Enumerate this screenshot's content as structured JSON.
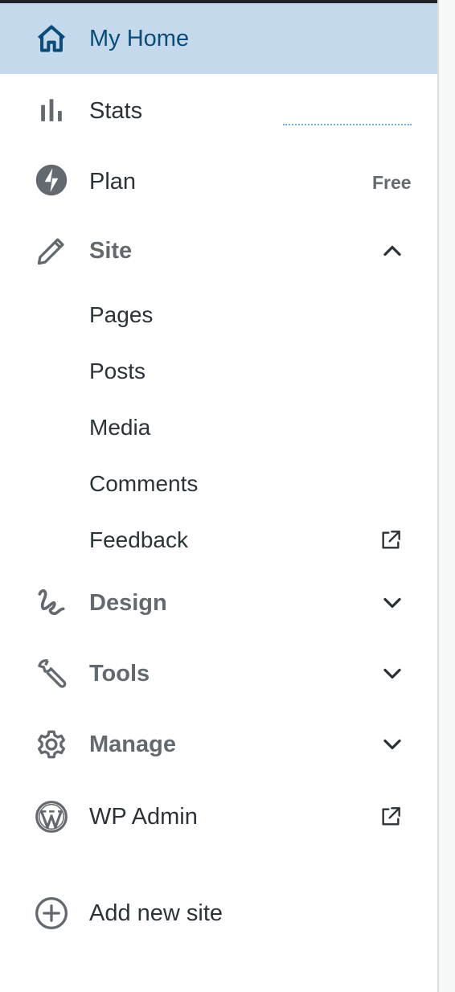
{
  "colors": {
    "selected_bg": "#c5d9ed",
    "selected_text": "#0a4b78",
    "icon_gray": "#646970",
    "text": "#2c3338",
    "sparkline": "#72aee6"
  },
  "nav": {
    "my_home": {
      "label": "My Home",
      "icon": "home-icon"
    },
    "stats": {
      "label": "Stats",
      "icon": "stats-bar-icon"
    },
    "plan": {
      "label": "Plan",
      "icon": "jetpack-bolt-icon",
      "badge": "Free"
    },
    "site": {
      "label": "Site",
      "icon": "pencil-icon",
      "expanded": true,
      "children": [
        {
          "label": "Pages"
        },
        {
          "label": "Posts"
        },
        {
          "label": "Media"
        },
        {
          "label": "Comments"
        },
        {
          "label": "Feedback",
          "external": true
        }
      ]
    },
    "design": {
      "label": "Design",
      "icon": "squiggle-brush-icon",
      "expanded": false
    },
    "tools": {
      "label": "Tools",
      "icon": "wrench-icon",
      "expanded": false
    },
    "manage": {
      "label": "Manage",
      "icon": "gear-icon",
      "expanded": false
    },
    "wp_admin": {
      "label": "WP Admin",
      "icon": "wordpress-logo-icon",
      "external": true
    },
    "add_site": {
      "label": "Add new site",
      "icon": "plus-circle-icon"
    }
  }
}
